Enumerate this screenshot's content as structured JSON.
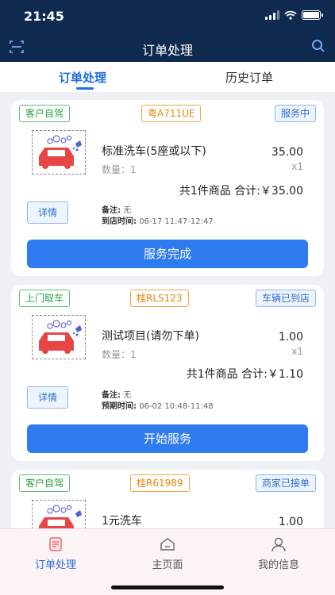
{
  "status_bar": {
    "time": "21:45"
  },
  "header": {
    "title": "订单处理",
    "scan_icon": "scan-icon",
    "search_icon": "search-icon"
  },
  "tabs": [
    {
      "label": "订单处理",
      "active": true
    },
    {
      "label": "历史订单",
      "active": false
    }
  ],
  "orders": [
    {
      "type_tag": "客户自驾",
      "plate": "粤A711UE",
      "status": "服务中",
      "product_name": "标准洗车(5座或以下)",
      "quantity_label": "数量：1",
      "price": "35.00",
      "multiplier": "x1",
      "total": "共1件商品  合计:￥35.00",
      "detail_label": "详情",
      "note_label": "备注:",
      "note_value": "无",
      "time_label": "到店时间:",
      "time_value": "06-17 11:47-12:47",
      "action_label": "服务完成"
    },
    {
      "type_tag": "上门取车",
      "plate": "桂RLS123",
      "status": "车辆已到店",
      "product_name": "测试项目(请勿下单)",
      "quantity_label": "数量：1",
      "price": "1.00",
      "multiplier": "x1",
      "total": "共1件商品  合计:￥1.10",
      "detail_label": "详情",
      "note_label": "备注:",
      "note_value": "无",
      "time_label": "预期时间:",
      "time_value": "06-02 10:48-11:48",
      "action_label": "开始服务"
    },
    {
      "type_tag": "客户自驾",
      "plate": "桂R61989",
      "status": "商家已接单",
      "product_name": "1元洗车",
      "price": "1.00"
    }
  ],
  "bottom_nav": [
    {
      "label": "订单处理",
      "icon": "order-list-icon",
      "active": true
    },
    {
      "label": "主页面",
      "icon": "home-icon",
      "active": false
    },
    {
      "label": "我的信息",
      "icon": "user-icon",
      "active": false
    }
  ],
  "colors": {
    "header_bg": "#0f2a4f",
    "primary": "#2f7bf0",
    "accent_blue": "#1f6fe0",
    "tag_green": "#2ba245",
    "tag_orange": "#e8850b"
  }
}
